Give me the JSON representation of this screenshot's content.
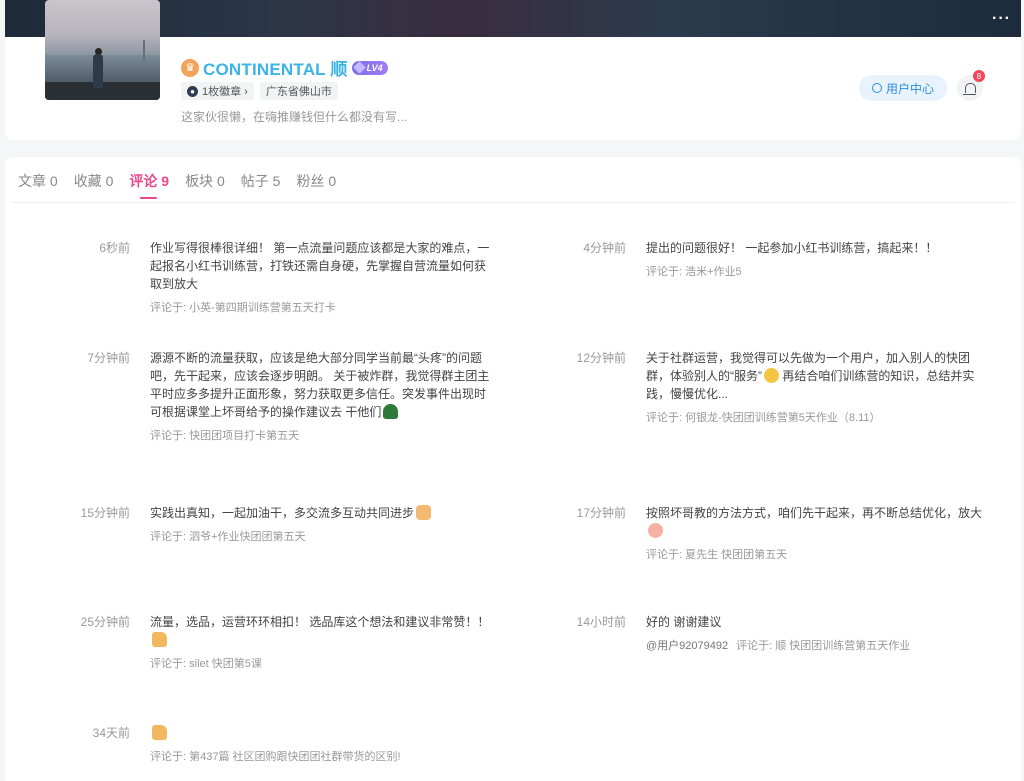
{
  "header": {
    "username": "CONTINENTAL 顺",
    "level": "LV4",
    "badge_tag": "1枚徽章 ›",
    "location": "广东省佛山市",
    "bio": "这家伙很懒，在嗨推赚钱但什么都没有写...",
    "user_center_label": "用户中心",
    "notification_count": "8",
    "more_label": "···"
  },
  "tabs": [
    {
      "label": "文章",
      "count": "0"
    },
    {
      "label": "收藏",
      "count": "0"
    },
    {
      "label": "评论",
      "count": "9"
    },
    {
      "label": "板块",
      "count": "0"
    },
    {
      "label": "帖子",
      "count": "5"
    },
    {
      "label": "粉丝",
      "count": "0"
    }
  ],
  "active_tab": "评论",
  "target_prefix": "评论于: ",
  "comments": [
    {
      "time": "6秒前",
      "text": "作业写得很棒很详细！ 第一点流量问题应该都是大家的难点，一起报名小红书训练营，打铁还需自身硬，先掌握自营流量如何获取到放大",
      "emoji": "",
      "target": "小英-第四期训练营第五天打卡",
      "mention": ""
    },
    {
      "time": "4分钟前",
      "text": "提出的问题很好！ 一起参加小红书训练营，搞起来！！",
      "emoji": "",
      "target": "浩米+作业5",
      "mention": ""
    },
    {
      "time": "7分钟前",
      "text": "源源不断的流量获取，应该是绝大部分同学当前最“头疼”的问题吧，先干起来，应该会逐步明朗。 关于被炸群，我觉得群主团主平时应多多提升正面形象，努力获取更多信任。突发事件出现时可根据课堂上坏哥给予的操作建议去 干他们",
      "emoji": "hat",
      "target": "快团团项目打卡第五天",
      "mention": ""
    },
    {
      "time": "12分钟前",
      "text": "关于社群运营，我觉得可以先做为一个用户，加入别人的快团群，体验别人的“服务”",
      "emoji": "grin",
      "text2": " 再结合咱们训练营的知识，总结并实践，慢慢优化...",
      "target": "何银龙-快团团训练营第5天作业（8.11）",
      "mention": ""
    },
    {
      "time": "15分钟前",
      "text": "实践出真知，一起加油干，多交流多互动共同进步",
      "emoji": "handshake",
      "target": "泗爷+作业快团团第五天",
      "mention": ""
    },
    {
      "time": "17分钟前",
      "text": "按照坏哥教的方法方式，咱们先干起来，再不断总结优化，放大",
      "emoji": "fist",
      "target": "夏先生 快团团第五天",
      "mention": ""
    },
    {
      "time": "25分钟前",
      "text": "流量，选品，运营环环相扣！ 选品库这个想法和建议非常赞！！",
      "emoji": "thumb",
      "target": "silet 快团第5课",
      "mention": ""
    },
    {
      "time": "14小时前",
      "text": "好的 谢谢建议",
      "emoji": "",
      "target": "顺 快团团训练营第五天作业",
      "mention": "@用户92079492"
    },
    {
      "time": "34天前",
      "text": "",
      "emoji": "thumb",
      "target": "第437篇 社区团购跟快团团社群带货的区别!",
      "mention": ""
    }
  ]
}
